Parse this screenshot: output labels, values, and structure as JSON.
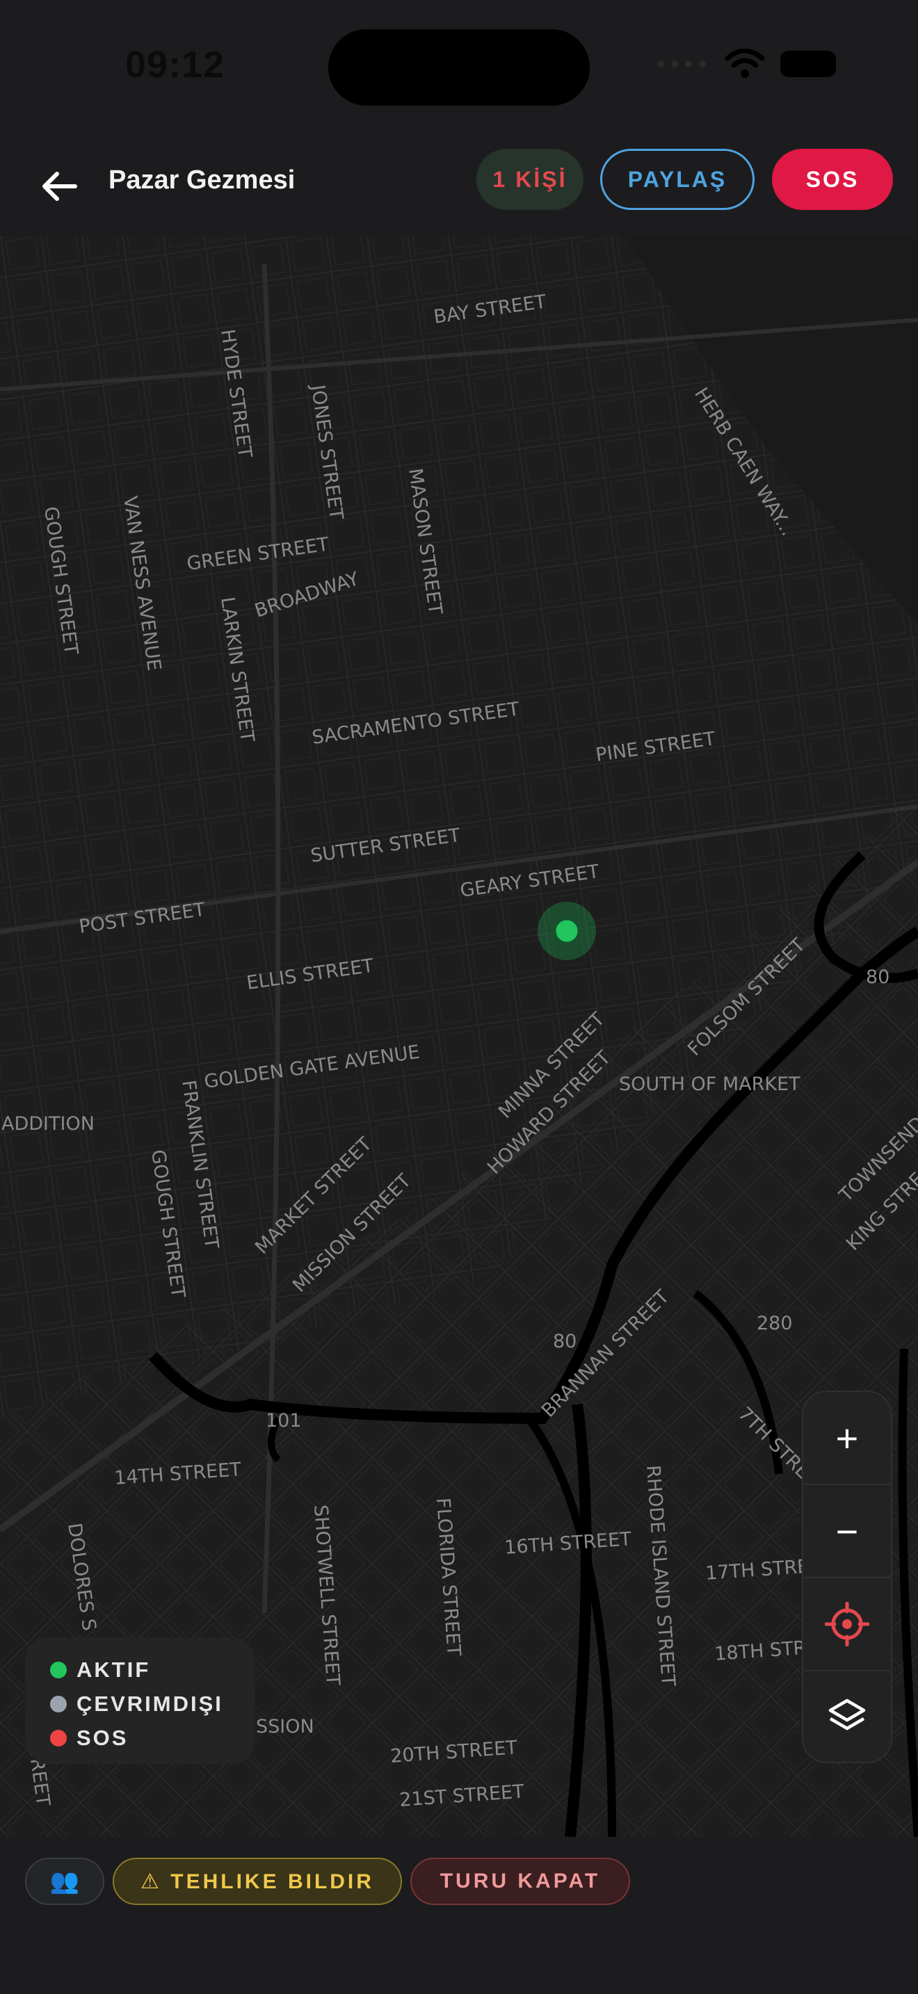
{
  "status_bar": {
    "time": "09:12"
  },
  "header": {
    "title": "Pazar Gezmesi",
    "count_label": "1 KİŞİ",
    "share_label": "PAYLAŞ",
    "sos_label": "SOS"
  },
  "map": {
    "streets": [
      "BAY STREET",
      "HYDE STREET",
      "JONES STREET",
      "MASON STREET",
      "HERB CAEN WAY...",
      "GOUGH STREET",
      "VAN NESS AVENUE",
      "GREEN STREET",
      "BROADWAY",
      "LARKIN STREET",
      "SACRAMENTO STREET",
      "PINE STREET",
      "SUTTER STREET",
      "GEARY STREET",
      "POST STREET",
      "ELLIS STREET",
      "FOLSOM STREET",
      "80",
      "MINNA STREET",
      "GOLDEN GATE AVENUE",
      "SOUTH OF MARKET",
      "HOWARD STREET",
      "ADDITION",
      "FRANKLIN STREET",
      "GOUGH STREET",
      "MARKET STREET",
      "MISSION STREET",
      "TOWNSEND",
      "KING STRE",
      "80",
      "BRANNAN STREET",
      "280",
      "101",
      "7TH STREE",
      "14TH STREET",
      "DOLORES S",
      "SHOTWELL STREET",
      "FLORIDA STREET",
      "16TH STREET",
      "RHODE ISLAND STREET",
      "17TH STRE",
      "18TH STR",
      "SSION",
      "20TH STREET",
      "21ST STREET",
      "REET"
    ]
  },
  "legend": {
    "items": [
      {
        "label": "AKTIF",
        "color": "#22c55e"
      },
      {
        "label": "ÇEVRIMDIŞI",
        "color": "#9ca3af"
      },
      {
        "label": "SOS",
        "color": "#ef4444"
      }
    ]
  },
  "controls": {
    "zoom_in": "+",
    "zoom_out": "−",
    "locate_icon": "crosshair-icon",
    "layers_icon": "layers-icon"
  },
  "bottom_bar": {
    "people_icon": "👥",
    "warn_label": "⚠ TEHLIKE BILDIR",
    "close_label": "TURU KAPAT"
  },
  "colors": {
    "accent_green": "#22c55e",
    "sos_red": "#e01845",
    "share_blue": "#4fa3e0"
  }
}
